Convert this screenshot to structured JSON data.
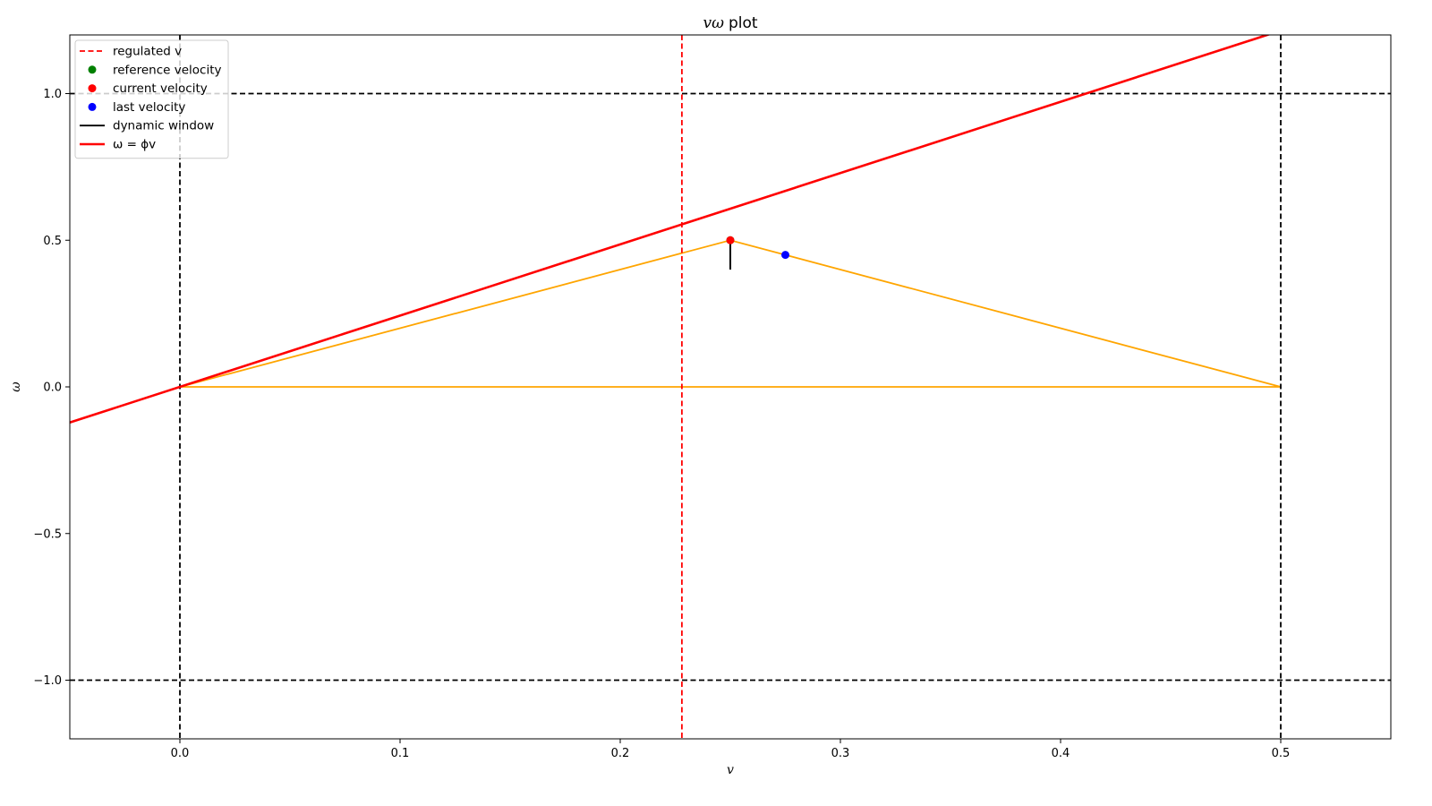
{
  "chart_data": {
    "type": "line",
    "title_math": "vω",
    "title_text": "plot",
    "xlabel": "v",
    "ylabel": "ω",
    "xlim": [
      -0.05,
      0.55
    ],
    "ylim": [
      -1.2,
      1.2
    ],
    "xticks": [
      0.0,
      0.1,
      0.2,
      0.3,
      0.4,
      0.5
    ],
    "xtick_labels": [
      "0.0",
      "0.1",
      "0.2",
      "0.3",
      "0.4",
      "0.5"
    ],
    "yticks": [
      -1.0,
      -0.5,
      0.0,
      0.5,
      1.0
    ],
    "ytick_labels": [
      "−1.0",
      "−0.5",
      "0.0",
      "0.5",
      "1.0"
    ],
    "grid": false,
    "legend_position": "top-left",
    "colors": {
      "red": "#ff0000",
      "green": "#008000",
      "blue": "#0000ff",
      "black": "#000000",
      "orange": "#ffa500"
    },
    "bounds": {
      "v_lines": [
        0.0,
        0.5
      ],
      "omega_lines": [
        -1.0,
        1.0
      ]
    },
    "regulated_v": 0.228,
    "reference_velocity": [
      0.25,
      0.5
    ],
    "current_velocity": [
      0.25,
      0.5
    ],
    "last_velocity": [
      0.275,
      0.45
    ],
    "dynamic_window": [
      [
        0.25,
        0.5
      ],
      [
        0.25,
        0.4
      ]
    ],
    "phi_line": {
      "slope": 2.43,
      "x_range": [
        -0.05,
        0.55
      ]
    },
    "feasible_region": [
      [
        0.0,
        0.0
      ],
      [
        0.5,
        0.0
      ],
      [
        0.25,
        0.5
      ]
    ],
    "legend": [
      {
        "label": "regulated v",
        "kind": "dashed",
        "color": "#ff0000"
      },
      {
        "label": "reference velocity",
        "kind": "dot",
        "color": "#008000"
      },
      {
        "label": "current velocity",
        "kind": "dot",
        "color": "#ff0000"
      },
      {
        "label": "last velocity",
        "kind": "dot",
        "color": "#0000ff"
      },
      {
        "label": "dynamic window",
        "kind": "line",
        "color": "#000000"
      },
      {
        "label": "ω = ϕv",
        "kind": "line-thick",
        "color": "#ff0000"
      }
    ]
  }
}
